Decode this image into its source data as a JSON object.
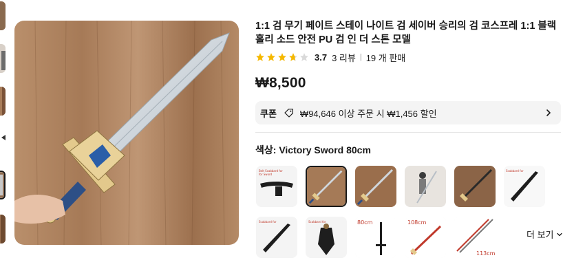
{
  "product": {
    "title": "1:1 검 무기 페이트 스테이 나이트 검 세이버 승리의 검 코스프레 1:1 블랙 홀리 소드 안전 PU 검 인 더 스톤 모델",
    "rating": "3.7",
    "review_count": "3 리뷰",
    "sold": "19 개 판매",
    "price": "₩8,500"
  },
  "coupon": {
    "label": "쿠폰",
    "text": "₩94,646 이상 주문 시 ₩1,456 할인"
  },
  "color": {
    "label": "색상:",
    "value": "Victory Sword 80cm"
  },
  "variant_texts": {
    "v6_red": "Scabbard for",
    "v9_len": "80cm",
    "v10_len": "108cm",
    "v11_len": "113cm"
  },
  "more_label": "더 보기",
  "colors": {
    "accent": "#191919",
    "star": "#f5b800",
    "star_empty": "#d9d9d9",
    "coupon_bg": "#f4f4f4"
  },
  "icons": [
    "star-icon",
    "tag-icon",
    "chevron-right-icon",
    "chevron-down-icon"
  ]
}
